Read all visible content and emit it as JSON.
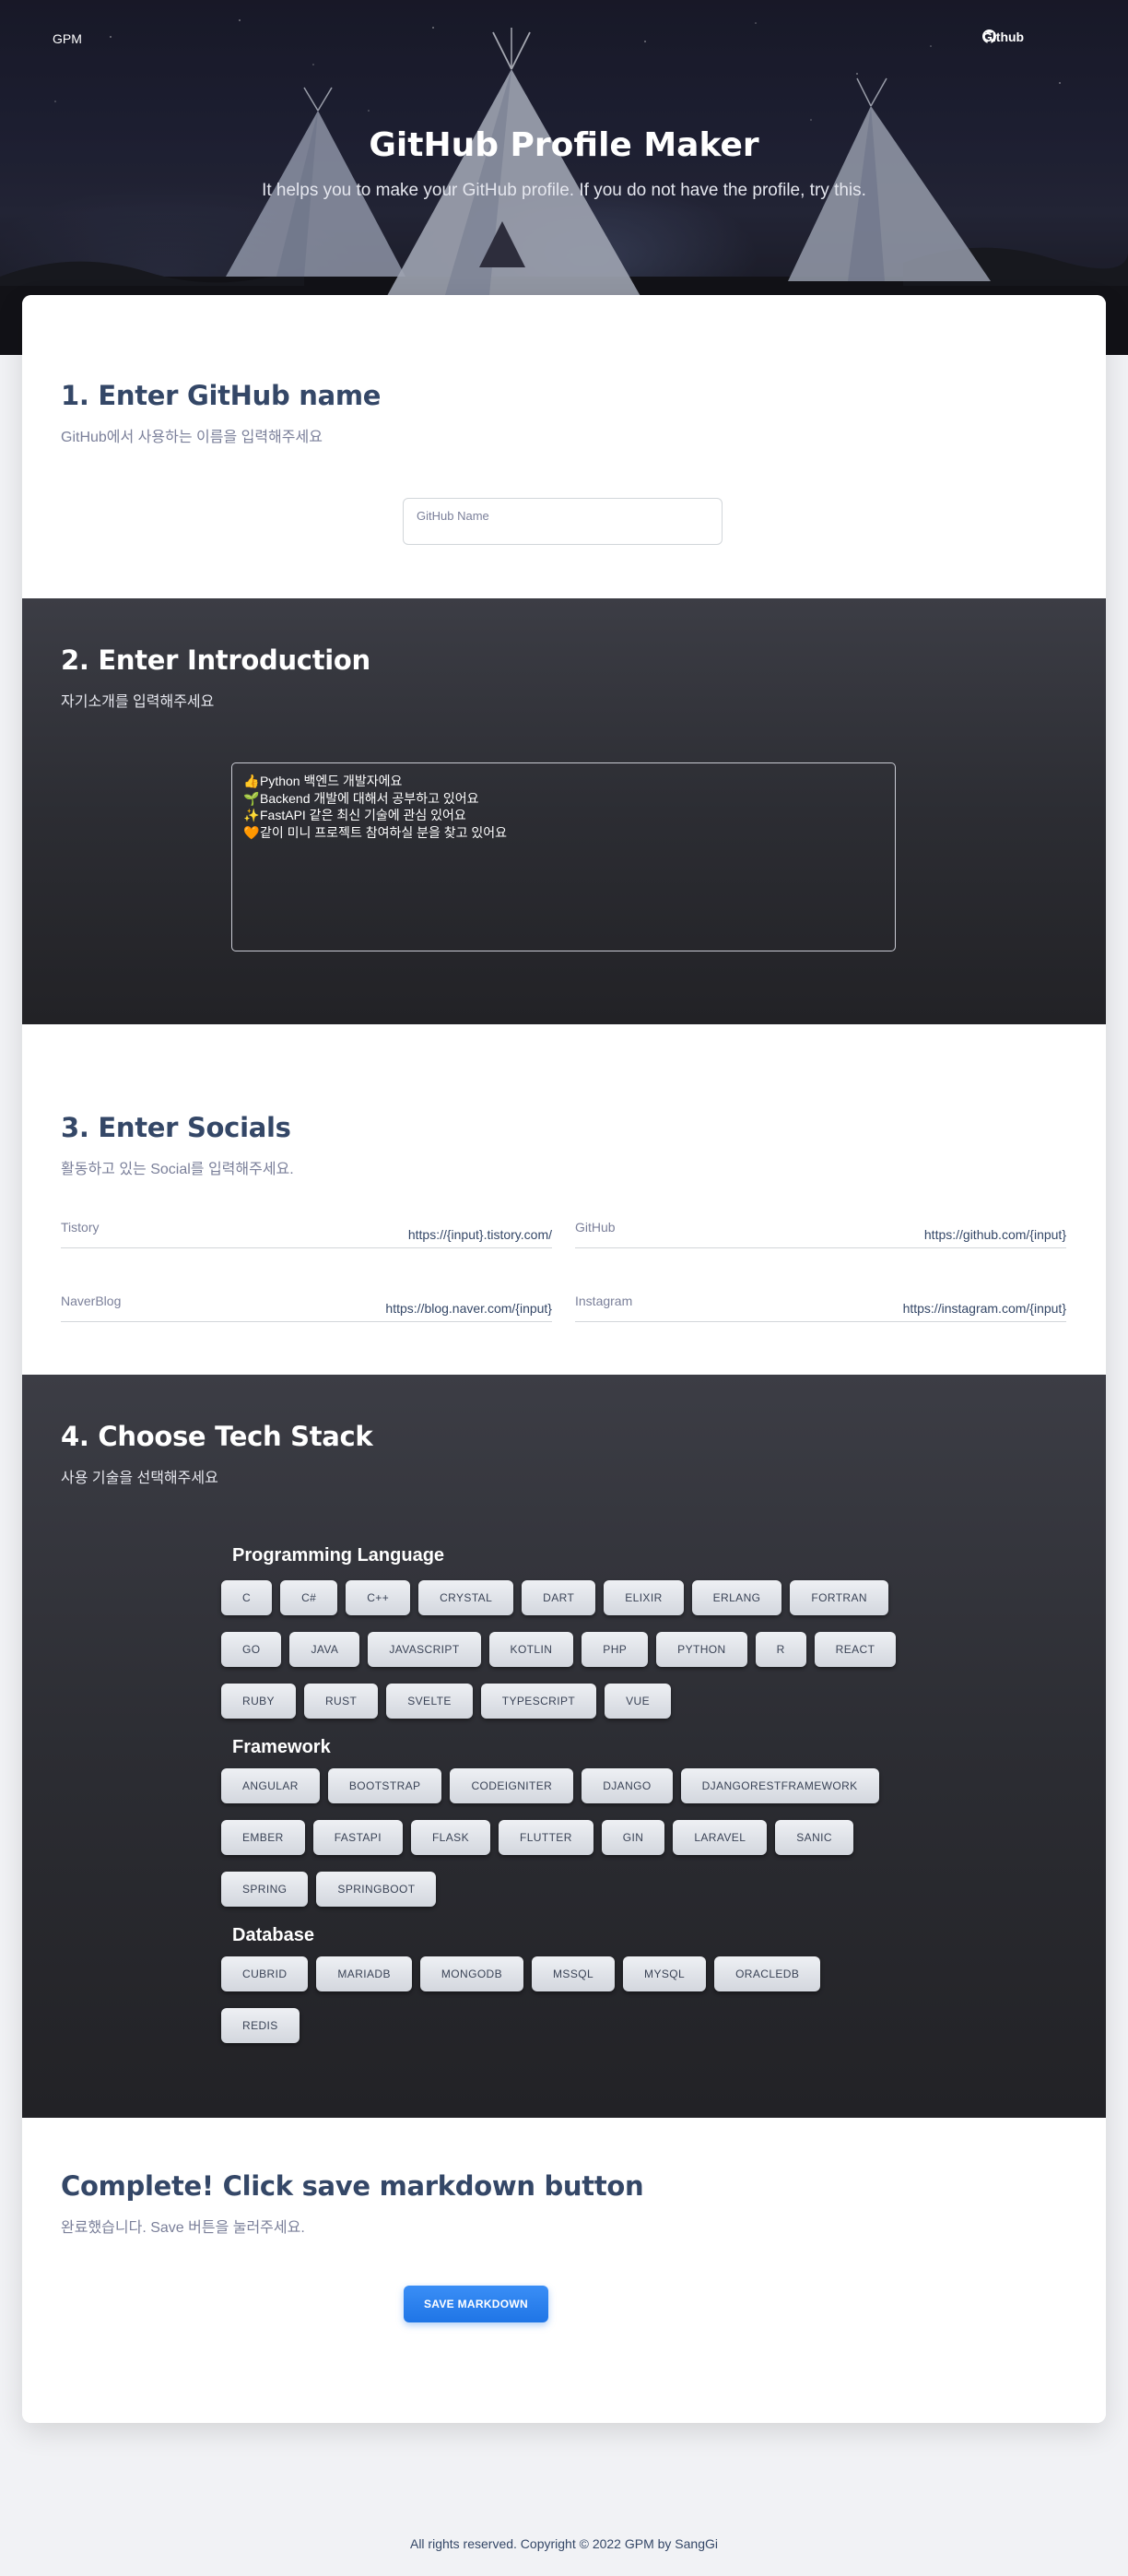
{
  "nav": {
    "brand": "GPM",
    "github_label": "Github"
  },
  "hero": {
    "title": "GitHub Profile Maker",
    "subtitle": "It helps you to make your GitHub profile. If you do not have the profile, try this."
  },
  "sections": {
    "name": {
      "title": "1. Enter GitHub name",
      "subtitle": "GitHub에서 사용하는 이름을 입력해주세요",
      "input_placeholder": "GitHub Name"
    },
    "intro": {
      "title": "2. Enter Introduction",
      "subtitle": "자기소개를 입력해주세요",
      "lines": [
        {
          "emoji": "👍",
          "text": "Python 백엔드 개발자에요"
        },
        {
          "emoji": "🌱",
          "text": "Backend 개발에 대해서 공부하고 있어요"
        },
        {
          "emoji": "✨",
          "text": "FastAPI 같은 최신 기술에 관심 있어요"
        },
        {
          "emoji": "🧡",
          "text": "같이 미니 프로젝트 참여하실 분을 찾고 있어요"
        }
      ]
    },
    "socials": {
      "title": "3. Enter Socials",
      "subtitle": "활동하고 있는 Social를 입력해주세요.",
      "fields": [
        {
          "label": "Tistory",
          "value": "https://{input}.tistory.com/"
        },
        {
          "label": "GitHub",
          "value": "https://github.com/{input}"
        },
        {
          "label": "NaverBlog",
          "value": "https://blog.naver.com/{input}"
        },
        {
          "label": "Instagram",
          "value": "https://instagram.com/{input}"
        }
      ]
    },
    "tech": {
      "title": "4. Choose Tech Stack",
      "subtitle": "사용 기술을 선택해주세요",
      "groups": [
        {
          "label": "Programming Language",
          "rows": [
            [
              "C",
              "C#",
              "C++",
              "CRYSTAL",
              "DART",
              "ELIXIR",
              "ERLANG",
              "FORTRAN"
            ],
            [
              "GO",
              "JAVA",
              "JAVASCRIPT",
              "KOTLIN",
              "PHP",
              "PYTHON",
              "R",
              "REACT"
            ],
            [
              "RUBY",
              "RUST",
              "SVELTE",
              "TYPESCRIPT",
              "VUE"
            ]
          ]
        },
        {
          "label": "Framework",
          "rows": [
            [
              "ANGULAR",
              "BOOTSTRAP",
              "CODEIGNITER",
              "DJANGO",
              "DJANGORESTFRAMEWORK"
            ],
            [
              "EMBER",
              "FASTAPI",
              "FLASK",
              "FLUTTER",
              "GIN",
              "LARAVEL",
              "SANIC"
            ],
            [
              "SPRING",
              "SPRINGBOOT"
            ]
          ]
        },
        {
          "label": "Database",
          "rows": [
            [
              "CUBRID",
              "MARIADB",
              "MONGODB",
              "MSSQL",
              "MYSQL",
              "ORACLEDB"
            ],
            [
              "REDIS"
            ]
          ]
        }
      ]
    },
    "complete": {
      "title": "Complete! Click save markdown button",
      "subtitle": "완료했습니다. Save 버튼을 눌러주세요.",
      "button_label": "SAVE MARKDOWN"
    }
  },
  "footer": {
    "text": "All rights reserved. Copyright © 2022 GPM by SangGi"
  },
  "colors": {
    "accent": "#1f75e6",
    "heading": "#344767",
    "muted": "#7b809a",
    "dark_section": "#2c2d33"
  }
}
